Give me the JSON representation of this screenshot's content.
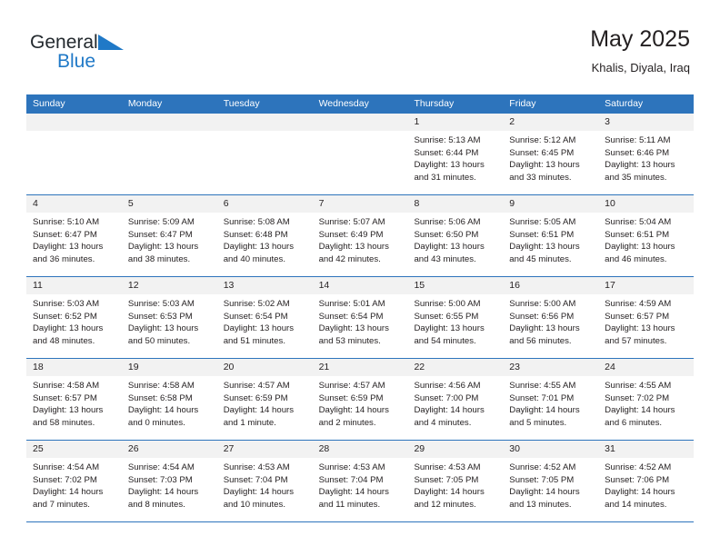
{
  "brand": {
    "name_top": "General",
    "name_bottom": "Blue",
    "accent_color": "#2079c7"
  },
  "header": {
    "title": "May 2025",
    "location": "Khalis, Diyala, Iraq"
  },
  "calendar": {
    "header_bg": "#2d74bc",
    "day_band_bg": "#f2f2f2",
    "weekday_names": [
      "Sunday",
      "Monday",
      "Tuesday",
      "Wednesday",
      "Thursday",
      "Friday",
      "Saturday"
    ],
    "labels": {
      "sunrise": "Sunrise:",
      "sunset": "Sunset:",
      "daylight": "Daylight:"
    },
    "weeks": [
      [
        {
          "day": ""
        },
        {
          "day": ""
        },
        {
          "day": ""
        },
        {
          "day": ""
        },
        {
          "day": "1",
          "sunrise": "Sunrise: 5:13 AM",
          "sunset": "Sunset: 6:44 PM",
          "daylight_1": "Daylight: 13 hours",
          "daylight_2": "and 31 minutes."
        },
        {
          "day": "2",
          "sunrise": "Sunrise: 5:12 AM",
          "sunset": "Sunset: 6:45 PM",
          "daylight_1": "Daylight: 13 hours",
          "daylight_2": "and 33 minutes."
        },
        {
          "day": "3",
          "sunrise": "Sunrise: 5:11 AM",
          "sunset": "Sunset: 6:46 PM",
          "daylight_1": "Daylight: 13 hours",
          "daylight_2": "and 35 minutes."
        }
      ],
      [
        {
          "day": "4",
          "sunrise": "Sunrise: 5:10 AM",
          "sunset": "Sunset: 6:47 PM",
          "daylight_1": "Daylight: 13 hours",
          "daylight_2": "and 36 minutes."
        },
        {
          "day": "5",
          "sunrise": "Sunrise: 5:09 AM",
          "sunset": "Sunset: 6:47 PM",
          "daylight_1": "Daylight: 13 hours",
          "daylight_2": "and 38 minutes."
        },
        {
          "day": "6",
          "sunrise": "Sunrise: 5:08 AM",
          "sunset": "Sunset: 6:48 PM",
          "daylight_1": "Daylight: 13 hours",
          "daylight_2": "and 40 minutes."
        },
        {
          "day": "7",
          "sunrise": "Sunrise: 5:07 AM",
          "sunset": "Sunset: 6:49 PM",
          "daylight_1": "Daylight: 13 hours",
          "daylight_2": "and 42 minutes."
        },
        {
          "day": "8",
          "sunrise": "Sunrise: 5:06 AM",
          "sunset": "Sunset: 6:50 PM",
          "daylight_1": "Daylight: 13 hours",
          "daylight_2": "and 43 minutes."
        },
        {
          "day": "9",
          "sunrise": "Sunrise: 5:05 AM",
          "sunset": "Sunset: 6:51 PM",
          "daylight_1": "Daylight: 13 hours",
          "daylight_2": "and 45 minutes."
        },
        {
          "day": "10",
          "sunrise": "Sunrise: 5:04 AM",
          "sunset": "Sunset: 6:51 PM",
          "daylight_1": "Daylight: 13 hours",
          "daylight_2": "and 46 minutes."
        }
      ],
      [
        {
          "day": "11",
          "sunrise": "Sunrise: 5:03 AM",
          "sunset": "Sunset: 6:52 PM",
          "daylight_1": "Daylight: 13 hours",
          "daylight_2": "and 48 minutes."
        },
        {
          "day": "12",
          "sunrise": "Sunrise: 5:03 AM",
          "sunset": "Sunset: 6:53 PM",
          "daylight_1": "Daylight: 13 hours",
          "daylight_2": "and 50 minutes."
        },
        {
          "day": "13",
          "sunrise": "Sunrise: 5:02 AM",
          "sunset": "Sunset: 6:54 PM",
          "daylight_1": "Daylight: 13 hours",
          "daylight_2": "and 51 minutes."
        },
        {
          "day": "14",
          "sunrise": "Sunrise: 5:01 AM",
          "sunset": "Sunset: 6:54 PM",
          "daylight_1": "Daylight: 13 hours",
          "daylight_2": "and 53 minutes."
        },
        {
          "day": "15",
          "sunrise": "Sunrise: 5:00 AM",
          "sunset": "Sunset: 6:55 PM",
          "daylight_1": "Daylight: 13 hours",
          "daylight_2": "and 54 minutes."
        },
        {
          "day": "16",
          "sunrise": "Sunrise: 5:00 AM",
          "sunset": "Sunset: 6:56 PM",
          "daylight_1": "Daylight: 13 hours",
          "daylight_2": "and 56 minutes."
        },
        {
          "day": "17",
          "sunrise": "Sunrise: 4:59 AM",
          "sunset": "Sunset: 6:57 PM",
          "daylight_1": "Daylight: 13 hours",
          "daylight_2": "and 57 minutes."
        }
      ],
      [
        {
          "day": "18",
          "sunrise": "Sunrise: 4:58 AM",
          "sunset": "Sunset: 6:57 PM",
          "daylight_1": "Daylight: 13 hours",
          "daylight_2": "and 58 minutes."
        },
        {
          "day": "19",
          "sunrise": "Sunrise: 4:58 AM",
          "sunset": "Sunset: 6:58 PM",
          "daylight_1": "Daylight: 14 hours",
          "daylight_2": "and 0 minutes."
        },
        {
          "day": "20",
          "sunrise": "Sunrise: 4:57 AM",
          "sunset": "Sunset: 6:59 PM",
          "daylight_1": "Daylight: 14 hours",
          "daylight_2": "and 1 minute."
        },
        {
          "day": "21",
          "sunrise": "Sunrise: 4:57 AM",
          "sunset": "Sunset: 6:59 PM",
          "daylight_1": "Daylight: 14 hours",
          "daylight_2": "and 2 minutes."
        },
        {
          "day": "22",
          "sunrise": "Sunrise: 4:56 AM",
          "sunset": "Sunset: 7:00 PM",
          "daylight_1": "Daylight: 14 hours",
          "daylight_2": "and 4 minutes."
        },
        {
          "day": "23",
          "sunrise": "Sunrise: 4:55 AM",
          "sunset": "Sunset: 7:01 PM",
          "daylight_1": "Daylight: 14 hours",
          "daylight_2": "and 5 minutes."
        },
        {
          "day": "24",
          "sunrise": "Sunrise: 4:55 AM",
          "sunset": "Sunset: 7:02 PM",
          "daylight_1": "Daylight: 14 hours",
          "daylight_2": "and 6 minutes."
        }
      ],
      [
        {
          "day": "25",
          "sunrise": "Sunrise: 4:54 AM",
          "sunset": "Sunset: 7:02 PM",
          "daylight_1": "Daylight: 14 hours",
          "daylight_2": "and 7 minutes."
        },
        {
          "day": "26",
          "sunrise": "Sunrise: 4:54 AM",
          "sunset": "Sunset: 7:03 PM",
          "daylight_1": "Daylight: 14 hours",
          "daylight_2": "and 8 minutes."
        },
        {
          "day": "27",
          "sunrise": "Sunrise: 4:53 AM",
          "sunset": "Sunset: 7:04 PM",
          "daylight_1": "Daylight: 14 hours",
          "daylight_2": "and 10 minutes."
        },
        {
          "day": "28",
          "sunrise": "Sunrise: 4:53 AM",
          "sunset": "Sunset: 7:04 PM",
          "daylight_1": "Daylight: 14 hours",
          "daylight_2": "and 11 minutes."
        },
        {
          "day": "29",
          "sunrise": "Sunrise: 4:53 AM",
          "sunset": "Sunset: 7:05 PM",
          "daylight_1": "Daylight: 14 hours",
          "daylight_2": "and 12 minutes."
        },
        {
          "day": "30",
          "sunrise": "Sunrise: 4:52 AM",
          "sunset": "Sunset: 7:05 PM",
          "daylight_1": "Daylight: 14 hours",
          "daylight_2": "and 13 minutes."
        },
        {
          "day": "31",
          "sunrise": "Sunrise: 4:52 AM",
          "sunset": "Sunset: 7:06 PM",
          "daylight_1": "Daylight: 14 hours",
          "daylight_2": "and 14 minutes."
        }
      ]
    ]
  }
}
